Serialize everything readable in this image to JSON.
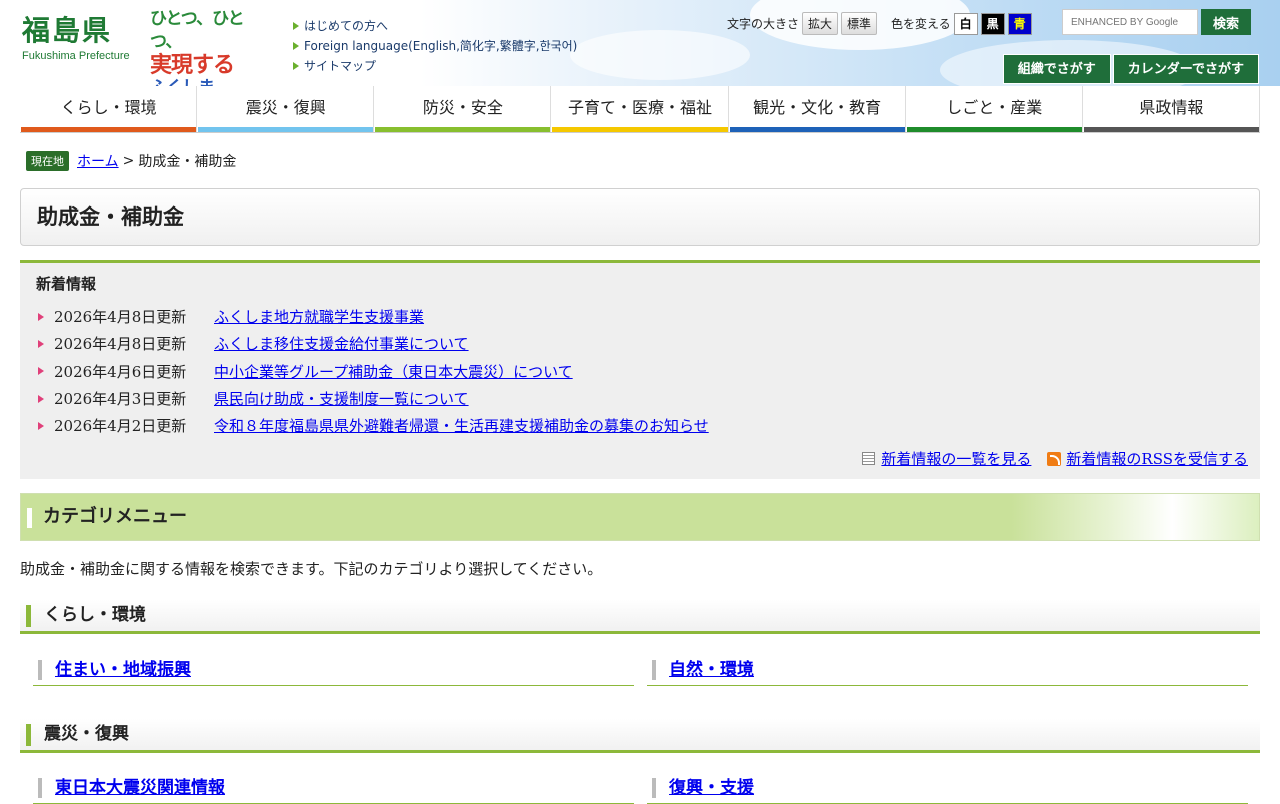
{
  "header": {
    "logo_jp": "福島県",
    "logo_en": "Fukushima Prefecture",
    "slogan_lines": [
      "ひとつ、ひとつ、",
      "実現する",
      "ふくしま"
    ],
    "top_links": [
      "はじめての方へ",
      "Foreign language(English,简化字,繁體字,한국어)",
      "サイトマップ"
    ],
    "font_size_label": "文字の大きさ",
    "font_enlarge": "拡大",
    "font_standard": "標準",
    "color_label": "色を変える",
    "color_white": "白",
    "color_black": "黒",
    "color_blue": "青",
    "search_placeholder": "ENHANCED BY Google",
    "search_button": "検索",
    "org_button": "組織でさがす",
    "calendar_button": "カレンダーでさがす"
  },
  "nav": [
    {
      "label": "くらし・環境",
      "color": "#e05a1c"
    },
    {
      "label": "震災・復興",
      "color": "#72c4ee"
    },
    {
      "label": "防災・安全",
      "color": "#88bf2f"
    },
    {
      "label": "子育て・医療・福祉",
      "color": "#f5c800"
    },
    {
      "label": "観光・文化・教育",
      "color": "#1e62b8"
    },
    {
      "label": "しごと・産業",
      "color": "#1f8c2b"
    },
    {
      "label": "県政情報",
      "color": "#555555"
    }
  ],
  "breadcrumb": {
    "badge": "現在地",
    "home": "ホーム",
    "separator": ">",
    "current": "助成金・補助金"
  },
  "page_title": "助成金・補助金",
  "news": {
    "heading": "新着情報",
    "items": [
      {
        "date": "2026年4月8日更新",
        "title": "ふくしま地方就職学生支援事業"
      },
      {
        "date": "2026年4月8日更新",
        "title": "ふくしま移住支援金給付事業について"
      },
      {
        "date": "2026年4月6日更新",
        "title": "中小企業等グループ補助金（東日本大震災）について"
      },
      {
        "date": "2026年4月3日更新",
        "title": "県民向け助成・支援制度一覧について"
      },
      {
        "date": "2026年4月2日更新",
        "title": "令和８年度福島県県外避難者帰還・生活再建支援補助金の募集のお知らせ"
      }
    ],
    "list_link": "新着情報の一覧を見る",
    "rss_link": "新着情報のRSSを受信する"
  },
  "category": {
    "heading": "カテゴリメニュー",
    "description": "助成金・補助金に関する情報を検索できます。下記のカテゴリより選択してください。",
    "sections": [
      {
        "title": "くらし・環境",
        "links": [
          "住まい・地域振興",
          "自然・環境"
        ]
      },
      {
        "title": "震災・復興",
        "links": [
          "東日本大震災関連情報",
          "復興・支援"
        ]
      }
    ]
  }
}
